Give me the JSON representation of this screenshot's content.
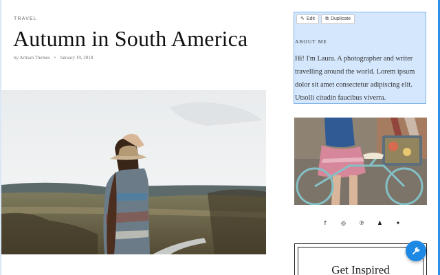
{
  "post": {
    "category": "TRAVEL",
    "title": "Autumn in South America",
    "author": "by Artisan Themes",
    "separator": "•",
    "date": "January 19, 2018",
    "hero_image": "woman-with-hat-in-field-photo"
  },
  "sidebar": {
    "edit_label": "Edit",
    "duplicate_label": "Duplicate",
    "about_heading": "ABOUT ME",
    "about_text": "Hi! I'm Laura. A photographer and writer travelling around the world. Lorem ipsum dolor sit amet consectetur adipiscing elit. Utsolli citudin faucibus viverra.",
    "photo": "woman-with-bicycle-photo",
    "social_icons": [
      "facebook-icon",
      "instagram-icon",
      "pinterest-icon",
      "snapchat-icon",
      "twitter-icon"
    ],
    "social_glyphs": [
      "f",
      "◎",
      "℗",
      "♟",
      "✦"
    ],
    "inspired_title": "Get Inspired"
  },
  "colors": {
    "selection_bg": "#d4e7fd",
    "selection_border": "#7fb4ec",
    "fab": "#1e88e5"
  }
}
